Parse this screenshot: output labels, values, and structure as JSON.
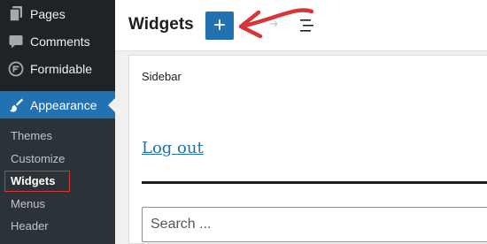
{
  "sidebar": {
    "items": [
      {
        "label": "Pages",
        "icon": "pages-icon"
      },
      {
        "label": "Comments",
        "icon": "comments-icon"
      },
      {
        "label": "Formidable",
        "icon": "formidable-icon"
      },
      {
        "label": "Appearance",
        "icon": "appearance-icon",
        "active": true
      }
    ],
    "submenu": [
      {
        "label": "Themes"
      },
      {
        "label": "Customize"
      },
      {
        "label": "Widgets",
        "current": true
      },
      {
        "label": "Menus"
      },
      {
        "label": "Header"
      }
    ]
  },
  "header": {
    "title": "Widgets",
    "add_button": "+"
  },
  "widget_area": {
    "title": "Sidebar",
    "logout_link": "Log out",
    "search_placeholder": "Search ..."
  },
  "colors": {
    "sidebar_bg": "#1d2327",
    "submenu_bg": "#2c3338",
    "accent": "#2271b1",
    "annotation": "#d63638"
  }
}
